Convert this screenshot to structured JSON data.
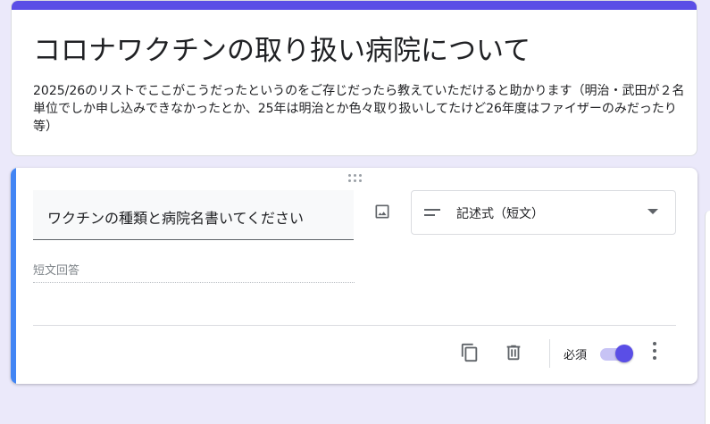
{
  "form": {
    "title": "コロナワクチンの取り扱い病院について",
    "description": "2025/26のリストでここがこうだったというのをご存じだったら教えていただけると助かります（明治・武田が２名単位でしか申し込みできなかったとか、25年は明治とか色々取り扱いしてたけど26年度はファイザーのみだったり等）",
    "accent_color": "#5a4ee6"
  },
  "question": {
    "text": "ワクチンの種類と病院名書いてください",
    "type_label": "記述式（短文）",
    "answer_placeholder": "短文回答",
    "required_label": "必須",
    "required": true,
    "accent_color": "#4285f4",
    "icons": {
      "drag": "drag-handle-icon",
      "image": "image-icon",
      "type": "short-text-icon",
      "dropdown": "arrow-drop-down-icon",
      "duplicate": "copy-icon",
      "delete": "trash-icon",
      "more": "more-vert-icon"
    }
  }
}
